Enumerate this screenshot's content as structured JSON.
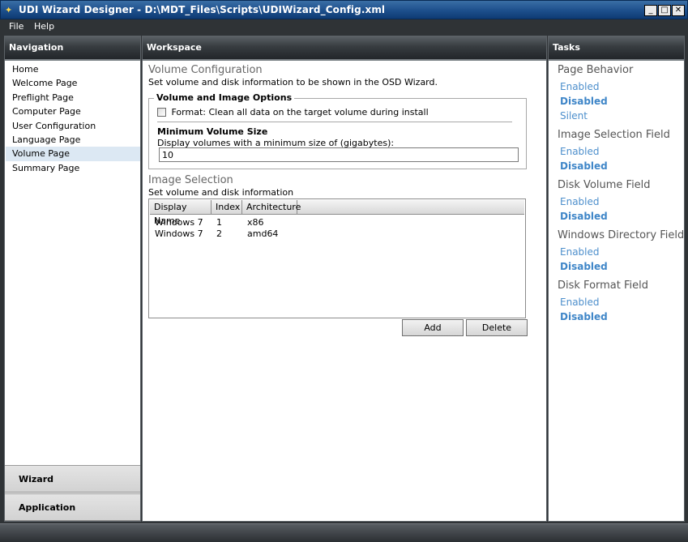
{
  "window": {
    "title": "UDI Wizard Designer - D:\\MDT_Files\\Scripts\\UDIWizard_Config.xml",
    "minimize_glyph": "_",
    "maximize_glyph": "□",
    "close_glyph": "✕"
  },
  "menubar": {
    "items": [
      {
        "label": "File"
      },
      {
        "label": "Help"
      }
    ]
  },
  "navigation": {
    "header": "Navigation",
    "items": [
      {
        "label": "Home"
      },
      {
        "label": "Welcome Page"
      },
      {
        "label": "Preflight Page"
      },
      {
        "label": "Computer Page"
      },
      {
        "label": "User Configuration"
      },
      {
        "label": "Language Page"
      },
      {
        "label": "Volume Page",
        "selected": true
      },
      {
        "label": "Summary Page"
      }
    ],
    "bottom_buttons": [
      {
        "label": "Wizard"
      },
      {
        "label": "Application"
      }
    ]
  },
  "workspace": {
    "header": "Workspace",
    "volume_config": {
      "title": "Volume Configuration",
      "description": "Set volume and disk information to be shown in the OSD Wizard."
    },
    "options_group": {
      "legend": "Volume and Image Options",
      "format_checkbox_label": "Format: Clean all data on the target volume during install",
      "format_checked": false,
      "min_volume_title": "Minimum Volume Size",
      "min_volume_desc": "Display volumes with a minimum size of (gigabytes):",
      "min_volume_value": "10"
    },
    "image_selection": {
      "title": "Image Selection",
      "description": "Set volume and disk information",
      "columns": [
        "Display Name",
        "Index",
        "Architecture"
      ],
      "rows": [
        {
          "name": "Windows 7",
          "index": "1",
          "arch": "x86"
        },
        {
          "name": "Windows 7",
          "index": "2",
          "arch": "amd64"
        }
      ],
      "add_label": "Add",
      "delete_label": "Delete"
    }
  },
  "tasks": {
    "header": "Tasks",
    "groups": [
      {
        "title": "Page Behavior",
        "options": [
          {
            "label": "Enabled"
          },
          {
            "label": "Disabled",
            "active": true
          },
          {
            "label": "Silent"
          }
        ]
      },
      {
        "title": "Image Selection Field",
        "options": [
          {
            "label": "Enabled"
          },
          {
            "label": "Disabled",
            "active": true
          }
        ]
      },
      {
        "title": "Disk Volume Field",
        "options": [
          {
            "label": "Enabled"
          },
          {
            "label": "Disabled",
            "active": true
          }
        ]
      },
      {
        "title": "Windows Directory Field",
        "options": [
          {
            "label": "Enabled"
          },
          {
            "label": "Disabled",
            "active": true
          }
        ]
      },
      {
        "title": "Disk Format Field",
        "options": [
          {
            "label": "Enabled"
          },
          {
            "label": "Disabled",
            "active": true
          }
        ]
      }
    ]
  },
  "colors": {
    "title_bar": "#1d4f8c",
    "panel_header": "#373c40",
    "task_link": "#4d8fcc",
    "selection": "#dce8f3"
  }
}
